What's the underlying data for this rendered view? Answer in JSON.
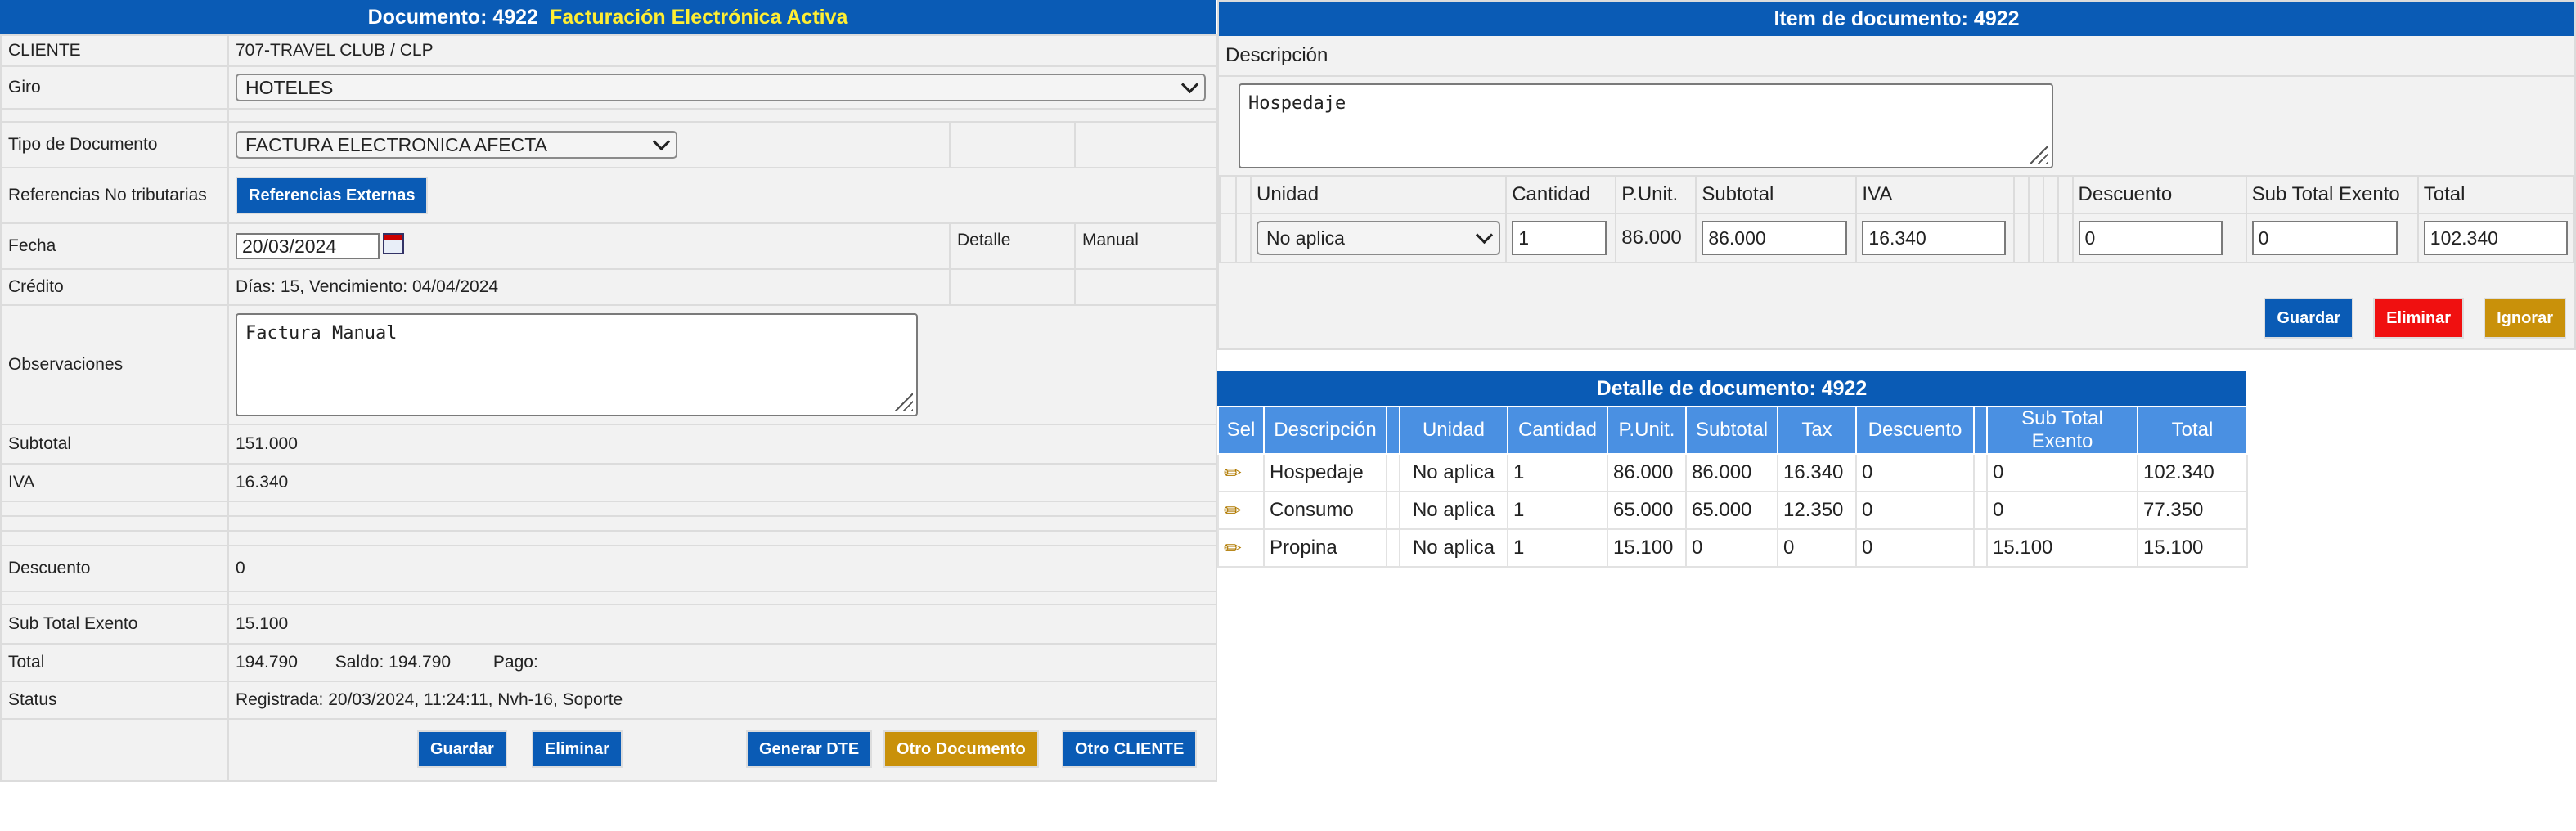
{
  "doc": {
    "title": "Documento: 4922",
    "status_badge": "Facturación Electrónica Activa",
    "cliente_label": "CLIENTE",
    "cliente_value": "707-TRAVEL CLUB / CLP",
    "giro_label": "Giro",
    "giro_value": "HOTELES",
    "tipo_label": "Tipo de Documento",
    "tipo_value": "FACTURA ELECTRONICA AFECTA",
    "refs_label": "Referencias No tributarias",
    "refs_button": "Referencias Externas",
    "fecha_label": "Fecha",
    "fecha_value": "20/03/2024",
    "detalle_label": "Detalle",
    "manual_label": "Manual",
    "credito_label": "Crédito",
    "credito_value": "Días: 15, Vencimiento: 04/04/2024",
    "obs_label": "Observaciones",
    "obs_value": "Factura Manual",
    "subtotal_label": "Subtotal",
    "subtotal_value": "151.000",
    "iva_label": "IVA",
    "iva_value": "16.340",
    "descuento_label": "Descuento",
    "descuento_value": "0",
    "exento_label": "Sub Total Exento",
    "exento_value": "15.100",
    "total_label": "Total",
    "total_value": "194.790",
    "saldo_text": "Saldo: 194.790",
    "pago_text": "Pago:",
    "status_label": "Status",
    "status_value": "Registrada: 20/03/2024, 11:24:11, Nvh-16, Soporte",
    "buttons": {
      "guardar": "Guardar",
      "eliminar": "Eliminar",
      "generar": "Generar DTE",
      "otro_doc": "Otro Documento",
      "otro_cliente": "Otro CLIENTE"
    }
  },
  "item": {
    "title": "Item de documento: 4922",
    "desc_label": "Descripción",
    "desc_value": "Hospedaje",
    "headers": {
      "unidad": "Unidad",
      "cantidad": "Cantidad",
      "punit": "P.Unit.",
      "subtotal": "Subtotal",
      "iva": "IVA",
      "descuento": "Descuento",
      "exento": "Sub Total Exento",
      "total": "Total"
    },
    "values": {
      "unidad": "No aplica",
      "cantidad": "1",
      "punit": "86.000",
      "subtotal": "86.000",
      "iva": "16.340",
      "descuento": "0",
      "exento": "0",
      "total": "102.340"
    },
    "buttons": {
      "guardar": "Guardar",
      "eliminar": "Eliminar",
      "ignorar": "Ignorar"
    }
  },
  "detalle": {
    "title": "Detalle de documento: 4922",
    "columns": [
      "Sel",
      "Descripción",
      "",
      "Unidad",
      "Cantidad",
      "P.Unit.",
      "Subtotal",
      "Tax",
      "Descuento",
      "",
      "Sub Total Exento",
      "Total"
    ],
    "rows": [
      [
        "",
        "Hospedaje",
        "",
        "No aplica",
        "1",
        "86.000",
        "86.000",
        "16.340",
        "0",
        "",
        "0",
        "102.340"
      ],
      [
        "",
        "Consumo",
        "",
        "No aplica",
        "1",
        "65.000",
        "65.000",
        "12.350",
        "0",
        "",
        "0",
        "77.350"
      ],
      [
        "",
        "Propina",
        "",
        "No aplica",
        "1",
        "15.100",
        "0",
        "0",
        "0",
        "",
        "15.100",
        "15.100"
      ]
    ]
  },
  "colors": {
    "header_blue": "#0a5bb5",
    "grid_header": "#4a90e2",
    "highlight_yellow": "#ffee33",
    "button_gold": "#c9910a",
    "button_red": "#f01010"
  }
}
